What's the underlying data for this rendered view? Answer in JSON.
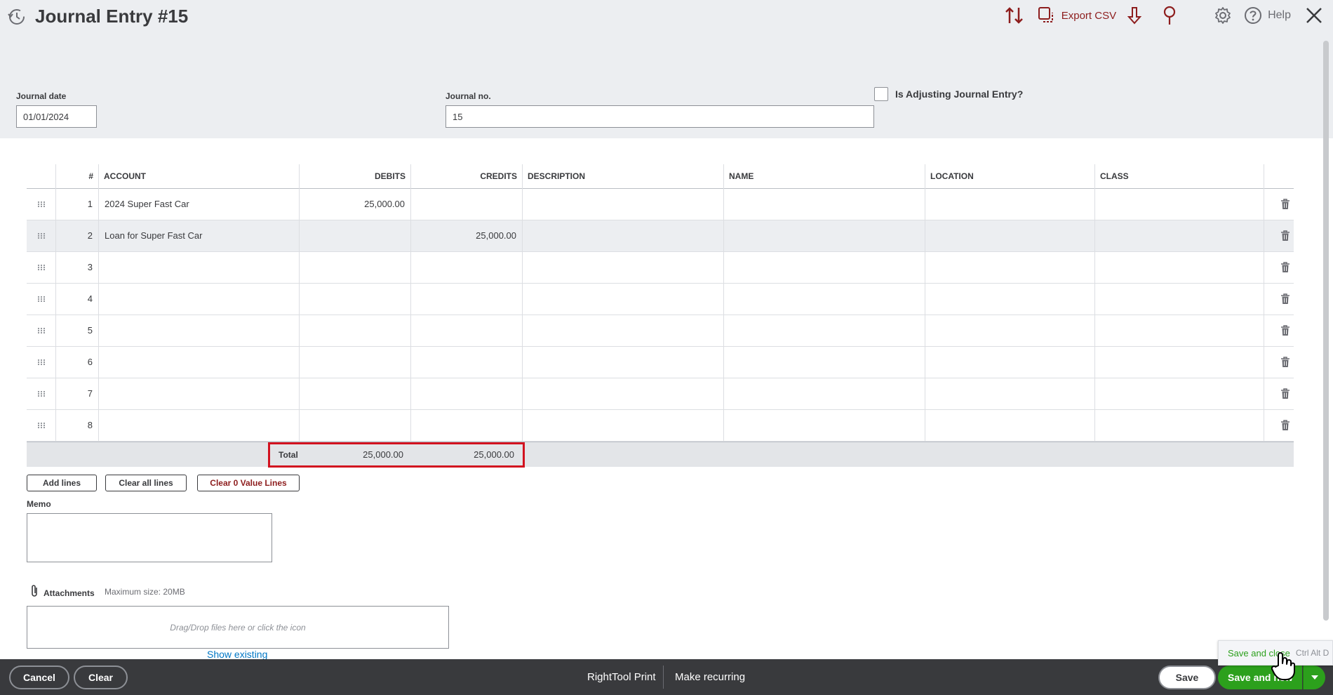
{
  "header": {
    "title": "Journal Entry #15",
    "export_label": "Export CSV",
    "help_label": "Help",
    "accent_color": "#8d1d1d"
  },
  "form": {
    "journal_date_label": "Journal date",
    "journal_date_value": "01/01/2024",
    "journal_no_label": "Journal no.",
    "journal_no_value": "15",
    "adjusting_label": "Is Adjusting Journal Entry?"
  },
  "table": {
    "columns": [
      "#",
      "ACCOUNT",
      "DEBITS",
      "CREDITS",
      "DESCRIPTION",
      "NAME",
      "LOCATION",
      "CLASS"
    ],
    "rows": [
      {
        "num": "1",
        "account": "2024 Super Fast Car",
        "debit": "25,000.00",
        "credit": "",
        "description": "",
        "name": "",
        "location": "",
        "class": ""
      },
      {
        "num": "2",
        "account": "Loan for Super Fast Car",
        "debit": "",
        "credit": "25,000.00",
        "description": "",
        "name": "",
        "location": "",
        "class": ""
      },
      {
        "num": "3",
        "account": "",
        "debit": "",
        "credit": "",
        "description": "",
        "name": "",
        "location": "",
        "class": ""
      },
      {
        "num": "4",
        "account": "",
        "debit": "",
        "credit": "",
        "description": "",
        "name": "",
        "location": "",
        "class": ""
      },
      {
        "num": "5",
        "account": "",
        "debit": "",
        "credit": "",
        "description": "",
        "name": "",
        "location": "",
        "class": ""
      },
      {
        "num": "6",
        "account": "",
        "debit": "",
        "credit": "",
        "description": "",
        "name": "",
        "location": "",
        "class": ""
      },
      {
        "num": "7",
        "account": "",
        "debit": "",
        "credit": "",
        "description": "",
        "name": "",
        "location": "",
        "class": ""
      },
      {
        "num": "8",
        "account": "",
        "debit": "",
        "credit": "",
        "description": "",
        "name": "",
        "location": "",
        "class": ""
      }
    ],
    "total_label": "Total",
    "total_debit": "25,000.00",
    "total_credit": "25,000.00"
  },
  "actions": {
    "add_lines": "Add lines",
    "clear_all_lines": "Clear all lines",
    "clear_zero_lines": "Clear 0 Value Lines"
  },
  "memo": {
    "label": "Memo",
    "value": ""
  },
  "attachments": {
    "label": "Attachments",
    "max_size": "Maximum size: 20MB",
    "drop_text": "Drag/Drop files here or click the icon",
    "show_existing": "Show existing"
  },
  "footer": {
    "cancel": "Cancel",
    "clear": "Clear",
    "print": "RightTool Print",
    "recurring": "Make recurring",
    "save": "Save",
    "save_and_new": "Save and new",
    "tooltip_text": "Save and close",
    "tooltip_shortcut": "Ctrl Alt D"
  },
  "icons": [
    "history-icon",
    "sort-arrows-icon",
    "copy-icon",
    "download-arrow-icon",
    "pin-icon",
    "gear-icon",
    "help-circle-icon",
    "close-icon",
    "drag-handle-icon",
    "trash-icon",
    "paperclip-icon",
    "caret-down-icon"
  ]
}
